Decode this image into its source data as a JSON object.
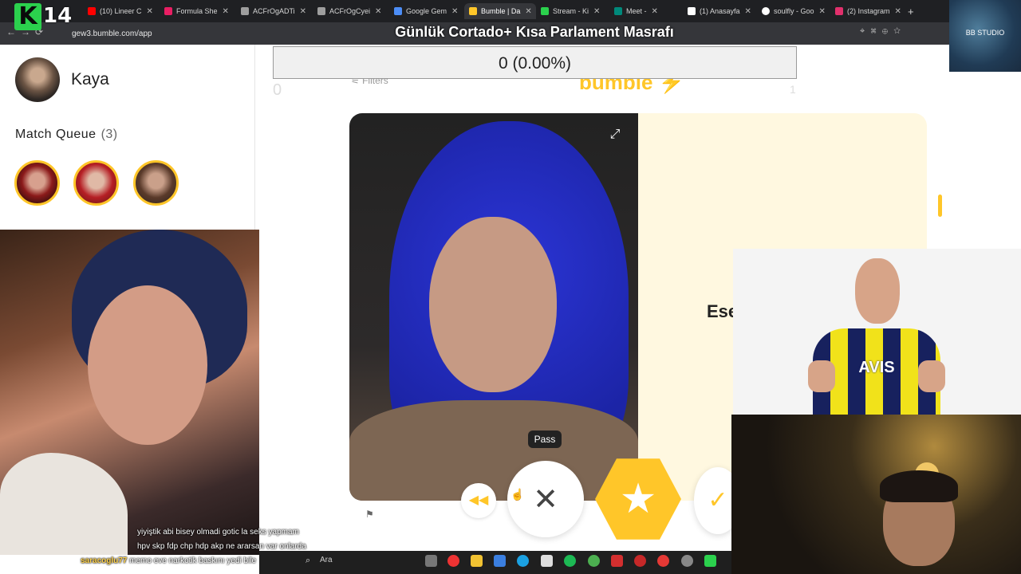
{
  "browser": {
    "tabs": [
      {
        "label": "(10) Lineer C",
        "color": "#ff0000"
      },
      {
        "label": "Formula She",
        "color": "#e91e63"
      },
      {
        "label": "ACFrOgADTi",
        "color": "#9e9e9e"
      },
      {
        "label": "ACFrOgCyei",
        "color": "#9e9e9e"
      },
      {
        "label": "Google Gem",
        "color": "#4c8df6"
      },
      {
        "label": "Bumble | Da",
        "color": "#ffc629"
      },
      {
        "label": "Stream - Ki",
        "color": "#2bd14d"
      },
      {
        "label": "Meet -",
        "color": "#00897b"
      },
      {
        "label": "(1) Anasayfa",
        "color": "#ffffff"
      },
      {
        "label": "soulfly - Goo",
        "color": "#ffffff"
      },
      {
        "label": "(2) Instagram",
        "color": "#e1306c"
      }
    ],
    "url": "gew3.bumble.com/app"
  },
  "overlay": {
    "logo_letter": "K",
    "logo_number": "14",
    "stream_title": "Günlük Cortado+ Kısa Parlament Masrafı",
    "progress_text": "0 (0.00%)",
    "studio_label": "BB STUDIO"
  },
  "sidebar": {
    "username": "Kaya",
    "match_queue_label": "Match Queue",
    "match_queue_count": "(3)"
  },
  "main": {
    "filters_label": "Filters",
    "logo_text": "bumble",
    "left_counter": "0",
    "right_counter": "1",
    "profile_name_partial": "Ese",
    "tooltip": "Pass"
  },
  "chat": [
    {
      "user": "",
      "text": "yiyiştik abi bisey olmadi gotic la seks yapmam"
    },
    {
      "user": "",
      "text": "hpv skp fdp chp hdp akp ne ararsan var onlarda"
    },
    {
      "user": "saracoglu77",
      "text": "memo eve narkotik baskını yedi bile"
    }
  ],
  "taskbar": {
    "search_label": "Ara"
  },
  "icons": {
    "expand": "expand-icon",
    "back": "rewind-icon",
    "pass": "close-icon",
    "superswipe": "star-icon",
    "like": "check-icon"
  },
  "colors": {
    "bumble_yellow": "#ffc629"
  }
}
